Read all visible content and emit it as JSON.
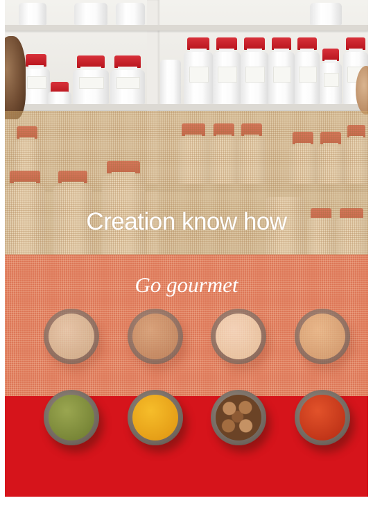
{
  "headline": "Creation know how",
  "subtitle": "Go gourmet",
  "colors": {
    "tan_band": "#d6b076",
    "salmon_band": "#dd7757",
    "red_band": "#d6141b",
    "text": "#ffffff"
  },
  "spice_bowls": {
    "top_row": [
      {
        "name": "white-powder-bowl",
        "color": "#cfc3a6"
      },
      {
        "name": "brown-powder-bowl",
        "color": "#c39a72"
      },
      {
        "name": "cream-powder-bowl",
        "color": "#efe1c3"
      },
      {
        "name": "beige-powder-bowl",
        "color": "#d9b98b"
      }
    ],
    "bottom_row": [
      {
        "name": "green-herb-bowl",
        "color": "#7e8a3a"
      },
      {
        "name": "turmeric-bowl",
        "color": "#e9a417"
      },
      {
        "name": "nutmeg-bowl",
        "color": "#9b6a42"
      },
      {
        "name": "paprika-bowl",
        "color": "#c9361a"
      }
    ]
  }
}
